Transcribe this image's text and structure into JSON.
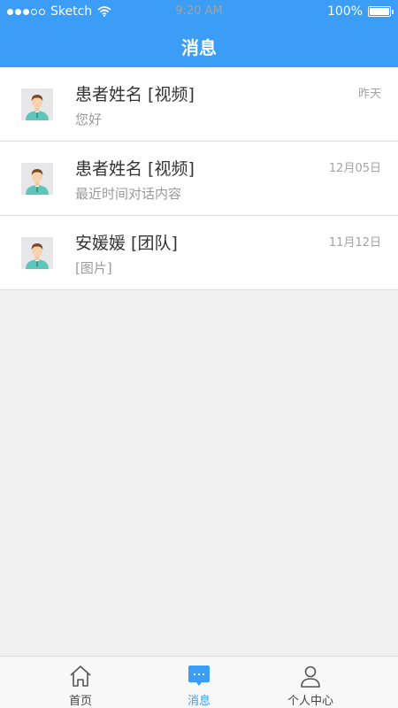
{
  "status_bar": {
    "carrier": "Sketch",
    "time": "9:20 AM",
    "battery": "100%"
  },
  "header": {
    "title": "消息"
  },
  "conversations": [
    {
      "name": "患者姓名 [视频]",
      "message": "您好",
      "time": "昨天"
    },
    {
      "name": "患者姓名 [视频]",
      "message": "最近时间对话内容",
      "time": "12月05日"
    },
    {
      "name": "安媛媛 [团队]",
      "message": "[图片]",
      "time": "11月12日"
    }
  ],
  "tabbar": {
    "tabs": [
      {
        "label": "首页",
        "icon": "home-icon",
        "active": false
      },
      {
        "label": "消息",
        "icon": "message-icon",
        "active": true
      },
      {
        "label": "个人中心",
        "icon": "person-icon",
        "active": false
      }
    ]
  },
  "colors": {
    "accent": "#3b9df6",
    "background": "#f0f0f0",
    "avatar_shirt": "#5cc6b8"
  }
}
